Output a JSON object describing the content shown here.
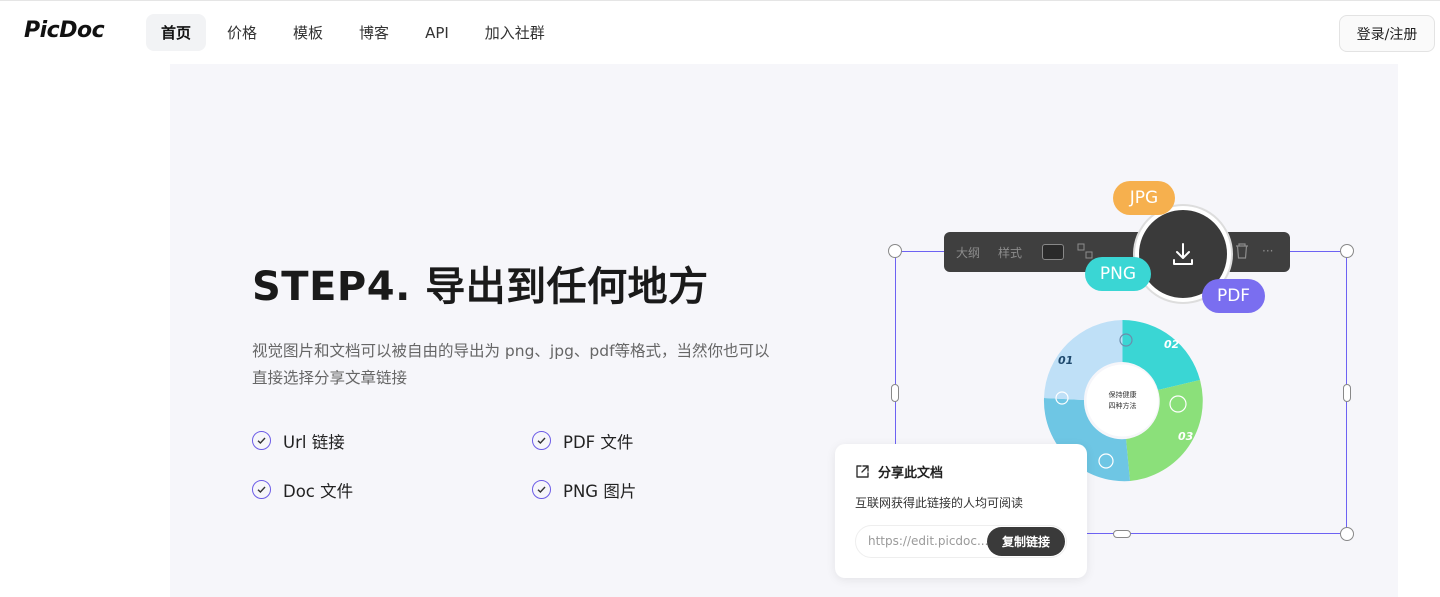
{
  "header": {
    "logo": "PicDoc",
    "nav": [
      "首页",
      "价格",
      "模板",
      "博客",
      "API",
      "加入社群"
    ],
    "login": "登录/注册"
  },
  "hero": {
    "title": "STEP4. 导出到任何地方",
    "description": "视觉图片和文档可以被自由的导出为 png、jpg、pdf等格式，当然你也可以直接选择分享文章链接",
    "features": [
      "Url 链接",
      "PDF 文件",
      "Doc 文件",
      "PNG 图片"
    ]
  },
  "illustration": {
    "toolbar": {
      "outline": "大纲",
      "style": "样式",
      "more": "···"
    },
    "formats": {
      "jpg": "JPG",
      "png": "PNG",
      "pdf": "PDF"
    },
    "diagram": {
      "center_line1": "保持健康",
      "center_line2": "四种方法",
      "step1": "01",
      "step2": "02",
      "step3": "03"
    },
    "share": {
      "title": "分享此文档",
      "subtitle": "互联网获得此链接的人均可阅读",
      "url": "https://edit.picdoc...",
      "copy": "复制链接"
    }
  },
  "colors": {
    "accent": "#6c5ce7",
    "jpg": "#f6b04e",
    "png": "#3ad6d4",
    "pdf": "#7a6ef0",
    "section_bg": "#f6f6fa"
  }
}
